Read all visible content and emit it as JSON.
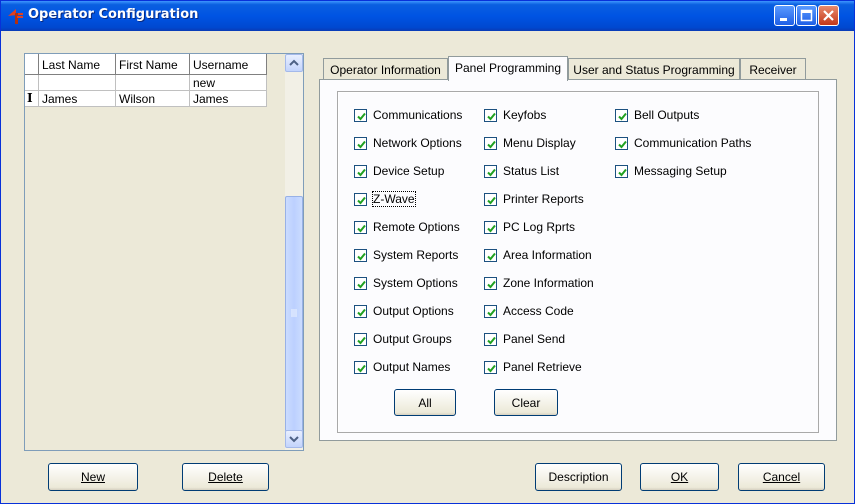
{
  "window": {
    "title": "Operator Configuration"
  },
  "grid": {
    "columns": [
      "Last Name",
      "First Name",
      "Username"
    ],
    "rows": [
      {
        "marker": "",
        "last": "",
        "first": "",
        "user": "new"
      },
      {
        "marker": "I",
        "last": "James",
        "first": "Wilson",
        "user": "James"
      }
    ]
  },
  "left_buttons": {
    "new": "New",
    "delete": "Delete"
  },
  "tabs": [
    "Operator Information",
    "Panel Programming",
    "User and Status Programming",
    "Receiver"
  ],
  "active_tab": "Panel Programming",
  "checkboxes": {
    "col1": [
      "Communications",
      "Network Options",
      "Device Setup",
      "Z-Wave",
      "Remote Options",
      "System Reports",
      "System Options",
      "Output Options",
      "Output Groups",
      "Output Names"
    ],
    "col2": [
      "Keyfobs",
      "Menu Display",
      "Status List",
      "Printer Reports",
      "PC Log Rprts",
      "Area Information",
      "Zone Information",
      "Access Code",
      "Panel Send",
      "Panel Retrieve"
    ],
    "col3": [
      "Bell Outputs",
      "Communication Paths",
      "Messaging Setup"
    ]
  },
  "panel_buttons": {
    "all": "All",
    "clear": "Clear"
  },
  "bottom_buttons": {
    "description": "Description",
    "ok": "OK",
    "cancel": "Cancel"
  }
}
